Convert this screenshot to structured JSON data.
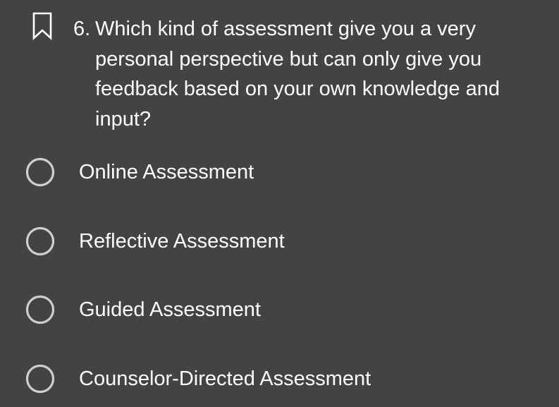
{
  "question": {
    "number": "6.",
    "text": "Which kind of assessment give you a very personal perspective but can only give you feedback based on your own knowledge and input?",
    "bookmark_icon": "bookmark-icon"
  },
  "options": [
    {
      "label": "Online Assessment",
      "selected": false
    },
    {
      "label": "Reflective Assessment",
      "selected": false
    },
    {
      "label": "Guided Assessment",
      "selected": false
    },
    {
      "label": "Counselor-Directed Assessment",
      "selected": false
    }
  ],
  "colors": {
    "background": "#434343",
    "text": "#ffffff",
    "radio_ring": "#cfcfcf"
  }
}
